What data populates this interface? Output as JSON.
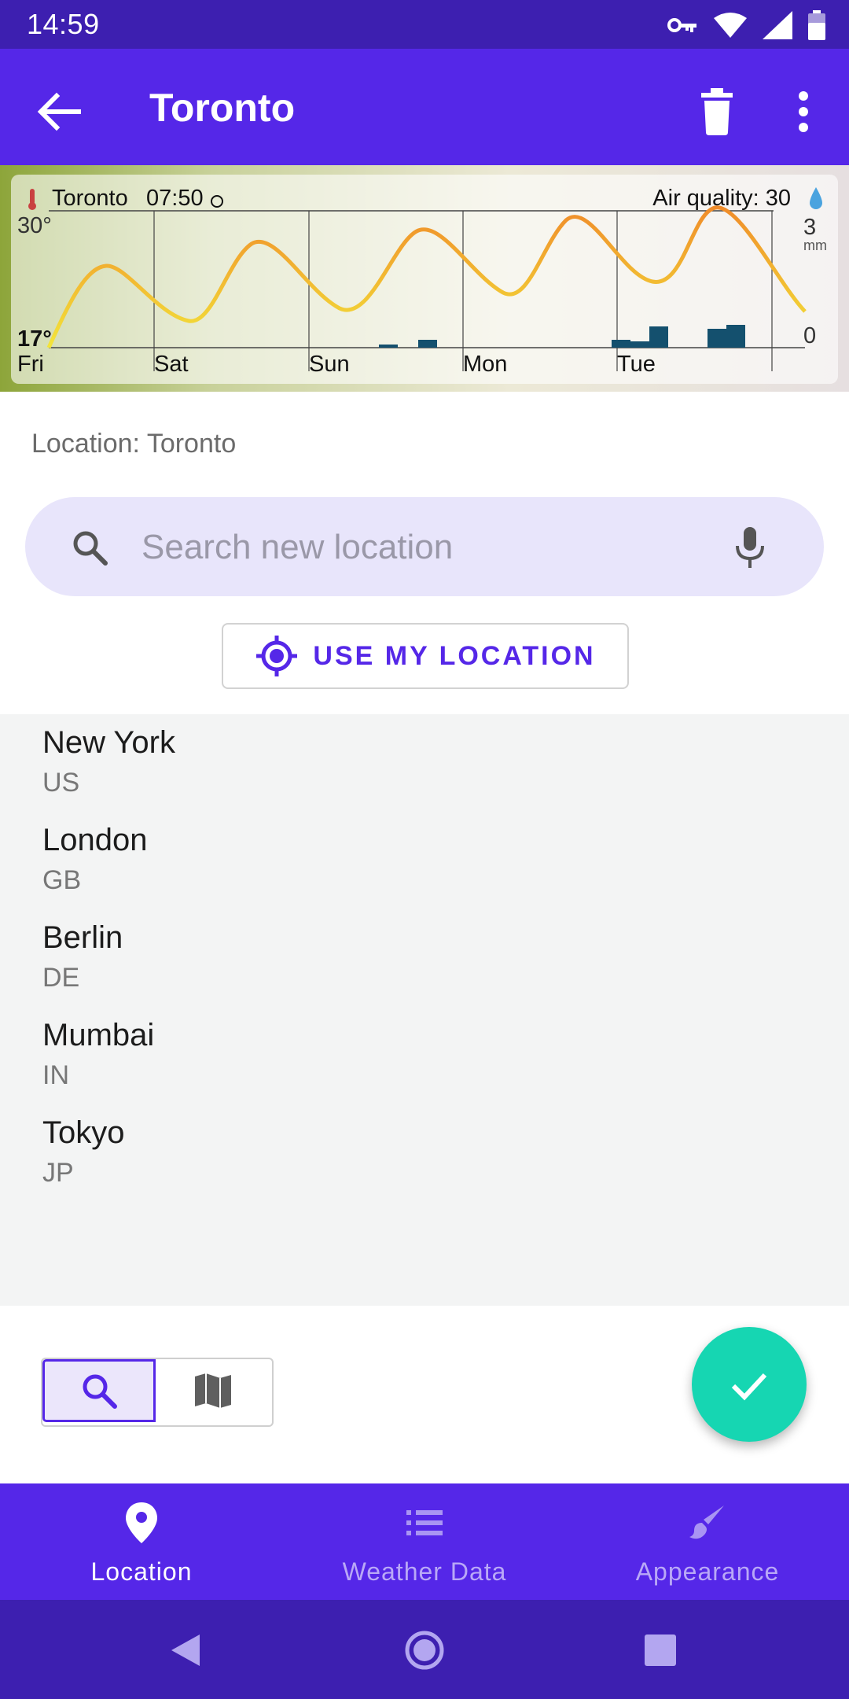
{
  "status_bar": {
    "time": "14:59",
    "icons": [
      "vpn-key-icon",
      "wifi-icon",
      "signal-icon",
      "battery-icon"
    ]
  },
  "app_bar": {
    "title": "Toronto",
    "back_icon": "arrow-back-icon",
    "delete_icon": "trash-icon",
    "more_icon": "more-vert-icon"
  },
  "forecast": {
    "location": "Toronto",
    "time": "07:50",
    "air_quality": "Air quality: 30",
    "temp_max": "30°",
    "temp_min": "17°",
    "precip_max": "3",
    "precip_unit": "mm",
    "precip_min": "0",
    "days": [
      "Fri",
      "Sat",
      "Sun",
      "Mon",
      "Tue"
    ]
  },
  "location_label": "Location: Toronto",
  "search": {
    "placeholder": "Search new location",
    "value": ""
  },
  "use_location": {
    "label": "USE MY LOCATION"
  },
  "suggestions": [
    {
      "city": "New York",
      "country": "US"
    },
    {
      "city": "London",
      "country": "GB"
    },
    {
      "city": "Berlin",
      "country": "DE"
    },
    {
      "city": "Mumbai",
      "country": "IN"
    },
    {
      "city": "Tokyo",
      "country": "JP"
    }
  ],
  "toggle": {
    "selected": "search",
    "options": [
      "search-icon",
      "map-icon"
    ]
  },
  "fab": {
    "icon": "check-icon"
  },
  "bottom_nav": [
    {
      "label": "Location",
      "icon": "location-pin-icon",
      "active": true
    },
    {
      "label": "Weather Data",
      "icon": "list-icon",
      "active": false
    },
    {
      "label": "Appearance",
      "icon": "brush-icon",
      "active": false
    }
  ],
  "colors": {
    "primary": "#5527e8",
    "status_bar": "#3d1fb0",
    "fab": "#16d6b2",
    "search_bg": "#e8e5fb",
    "list_bg": "#f3f4f4"
  }
}
